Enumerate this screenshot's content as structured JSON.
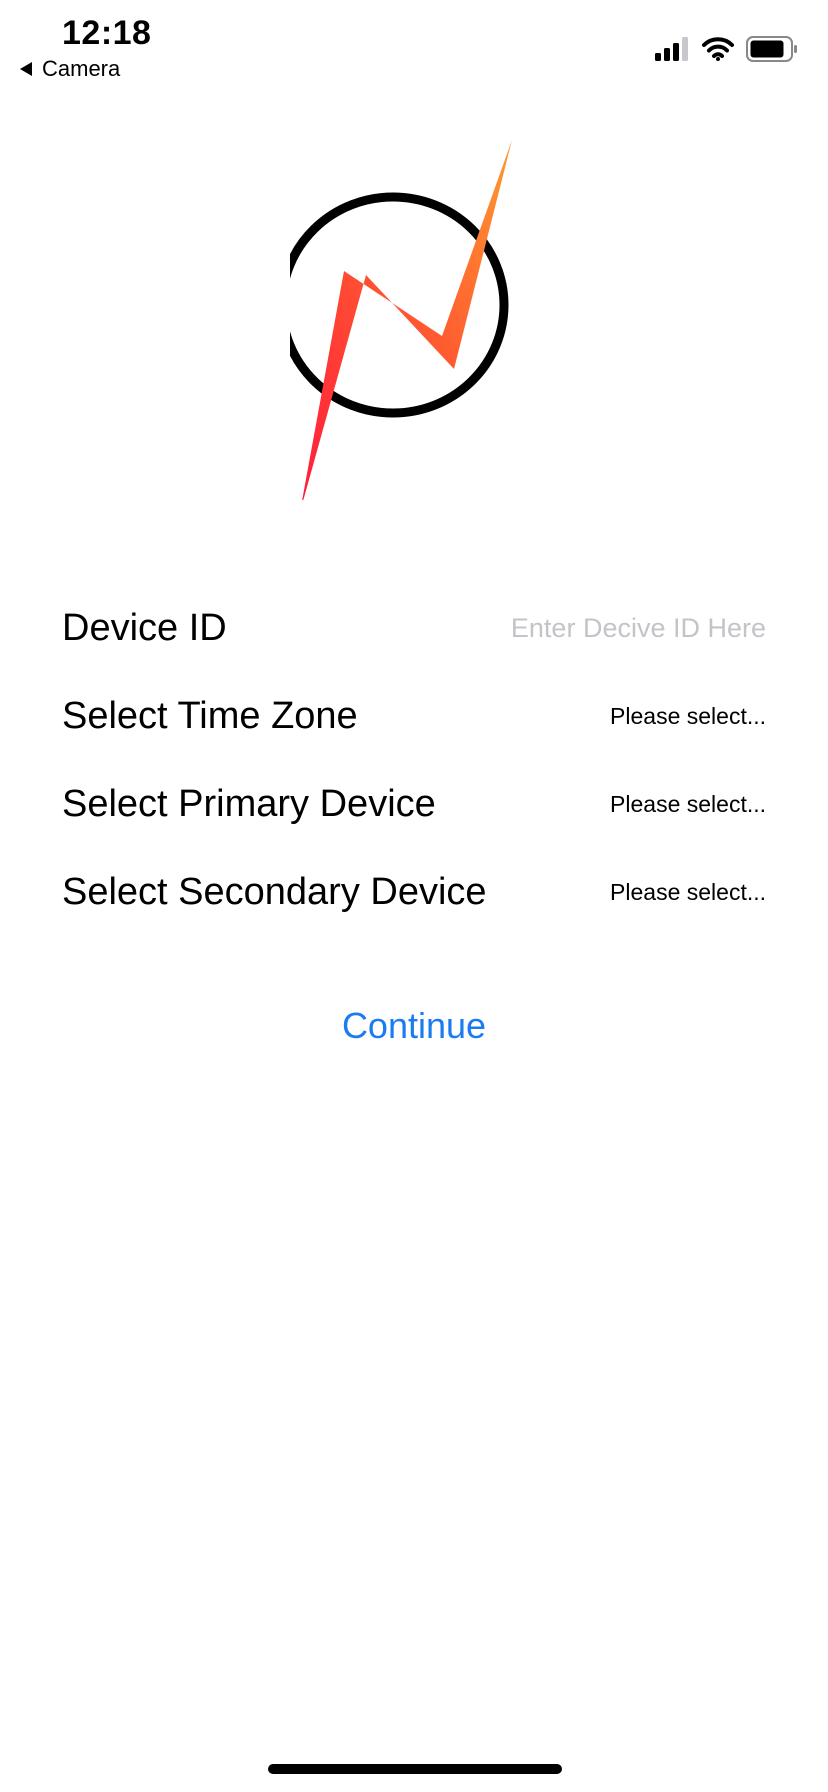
{
  "status_bar": {
    "time": "12:18",
    "back_label": "Camera"
  },
  "icons": {
    "signal": "cellular-signal-icon",
    "wifi": "wifi-icon",
    "battery": "battery-icon",
    "back": "back-triangle-icon",
    "logo": "lightning-bolt-logo"
  },
  "colors": {
    "accent": "#1a7cf0",
    "logo_gradient_start": "#ff1a3c",
    "logo_gradient_end": "#ff9a30",
    "placeholder": "#c4c4c8"
  },
  "form": {
    "device_id": {
      "label": "Device ID",
      "placeholder": "Enter Decive ID Here",
      "value": ""
    },
    "time_zone": {
      "label": "Select Time Zone",
      "value": "Please select..."
    },
    "primary_device": {
      "label": "Select Primary Device",
      "value": "Please select..."
    },
    "secondary_device": {
      "label": "Select Secondary Device",
      "value": "Please select..."
    },
    "continue_label": "Continue"
  }
}
